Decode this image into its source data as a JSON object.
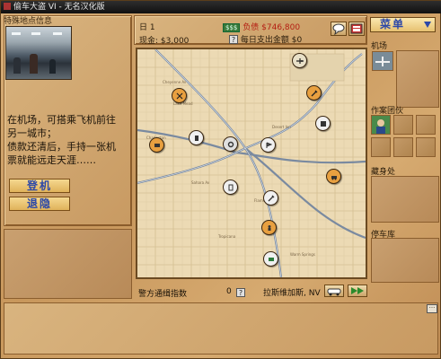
{
  "window": {
    "title": "偷车大盗 VI - 无名汉化版"
  },
  "location_panel": {
    "header": "特殊地点信息",
    "description_lines": [
      "在机场，可搭乘飞机前往",
      "另一城市；",
      "债款还清后，手持一张机",
      "票就能远走天涯……"
    ],
    "buttons": {
      "fly": "登机",
      "retire": "退隐"
    }
  },
  "stats": {
    "day_label": "日",
    "day_value": "1",
    "chip_text": "$$$",
    "debt_label": "负债",
    "debt_value": "$746,800",
    "cash_label": "现金",
    "cash_value": "$3,000",
    "help": "?",
    "daily_label": "每日支出金额",
    "daily_value": "$0"
  },
  "menu": {
    "label": "菜单"
  },
  "status_bar": {
    "police_label": "警方通缉指数",
    "police_value": "0",
    "help": "?",
    "city": "拉斯维加斯, NV"
  },
  "right_panel": {
    "airport_label": "机场",
    "team_label": "作案团伙",
    "hideout_label": "藏身处",
    "garage_label": "停车库"
  },
  "map": {
    "pins": [
      {
        "name": "airport-pin",
        "icon": "plane-icon",
        "color": "#e8e0c8"
      },
      {
        "name": "shop-pin-1",
        "icon": "wrench-icon",
        "color": "#e8a040"
      },
      {
        "name": "shop-pin-2",
        "icon": "tool-icon",
        "color": "#e8a040"
      },
      {
        "name": "shop-pin-3",
        "icon": "building-icon",
        "color": "#f0f0f0"
      },
      {
        "name": "shop-pin-4",
        "icon": "phone-icon",
        "color": "#f0f0f0"
      },
      {
        "name": "shop-pin-5",
        "icon": "gear-icon",
        "color": "#e0e0e0"
      },
      {
        "name": "shop-pin-6",
        "icon": "flag-icon",
        "color": "#e8a040"
      },
      {
        "name": "shop-pin-7",
        "icon": "cash-icon",
        "color": "#e8a040"
      },
      {
        "name": "shop-pin-8",
        "icon": "car-icon",
        "color": "#f0f0f0"
      },
      {
        "name": "shop-pin-9",
        "icon": "wrench-icon",
        "color": "#f0f0f0"
      },
      {
        "name": "shop-pin-10",
        "icon": "person-icon",
        "color": "#e8a040"
      },
      {
        "name": "shop-pin-11",
        "icon": "money-icon",
        "color": "#f0f0f0"
      },
      {
        "name": "shop-pin-12",
        "icon": "doc-icon",
        "color": "#f0f0f0"
      },
      {
        "name": "shop-pin-13",
        "icon": "people-icon",
        "color": "#f0f0f0"
      }
    ]
  }
}
